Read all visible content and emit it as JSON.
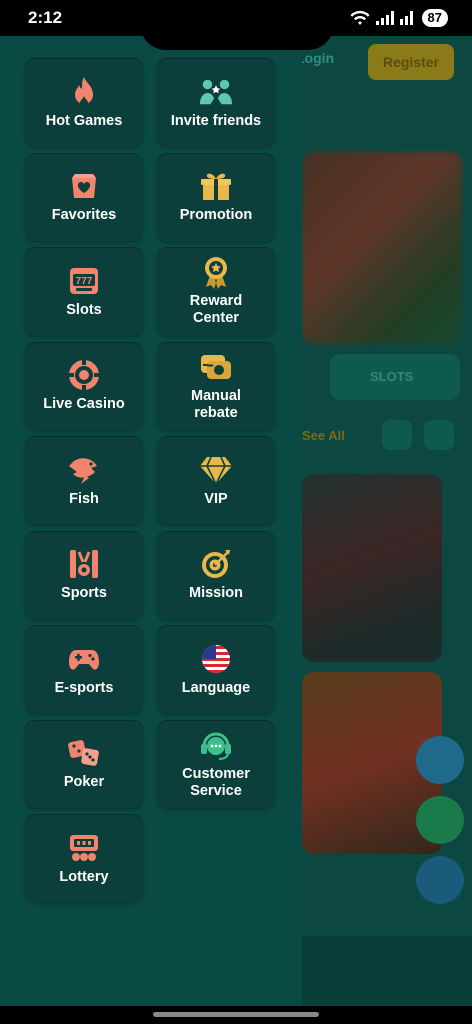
{
  "status": {
    "time": "2:12",
    "battery": "87"
  },
  "background": {
    "login": "Login",
    "register": "Register",
    "tab": "SLOTS",
    "see_all": "See All"
  },
  "menu": {
    "items": [
      {
        "label": "Hot Games",
        "icon": "flame-icon"
      },
      {
        "label": "Invite friends",
        "icon": "invite-friends-icon"
      },
      {
        "label": "Favorites",
        "icon": "heart-box-icon"
      },
      {
        "label": "Promotion",
        "icon": "gift-icon"
      },
      {
        "label": "Slots",
        "icon": "slot-machine-icon"
      },
      {
        "label": "Reward\nCenter",
        "icon": "medal-icon"
      },
      {
        "label": "Live Casino",
        "icon": "casino-chip-icon"
      },
      {
        "label": "Manual\nrebate",
        "icon": "rebate-icon"
      },
      {
        "label": "Fish",
        "icon": "shark-icon"
      },
      {
        "label": "VIP",
        "icon": "diamond-icon"
      },
      {
        "label": "Sports",
        "icon": "sports-icon"
      },
      {
        "label": "Mission",
        "icon": "target-icon"
      },
      {
        "label": "E-sports",
        "icon": "gamepad-icon"
      },
      {
        "label": "Language",
        "icon": "us-flag-icon"
      },
      {
        "label": "Poker",
        "icon": "dice-icon"
      },
      {
        "label": "Customer\nService",
        "icon": "headset-icon"
      },
      {
        "label": "Lottery",
        "icon": "lottery-icon"
      }
    ]
  },
  "colors": {
    "accent": "#f2846d",
    "gold": "#e8b94a",
    "drawer_bg": "#0a4a44",
    "tile_bg": "#0c3f3c"
  }
}
